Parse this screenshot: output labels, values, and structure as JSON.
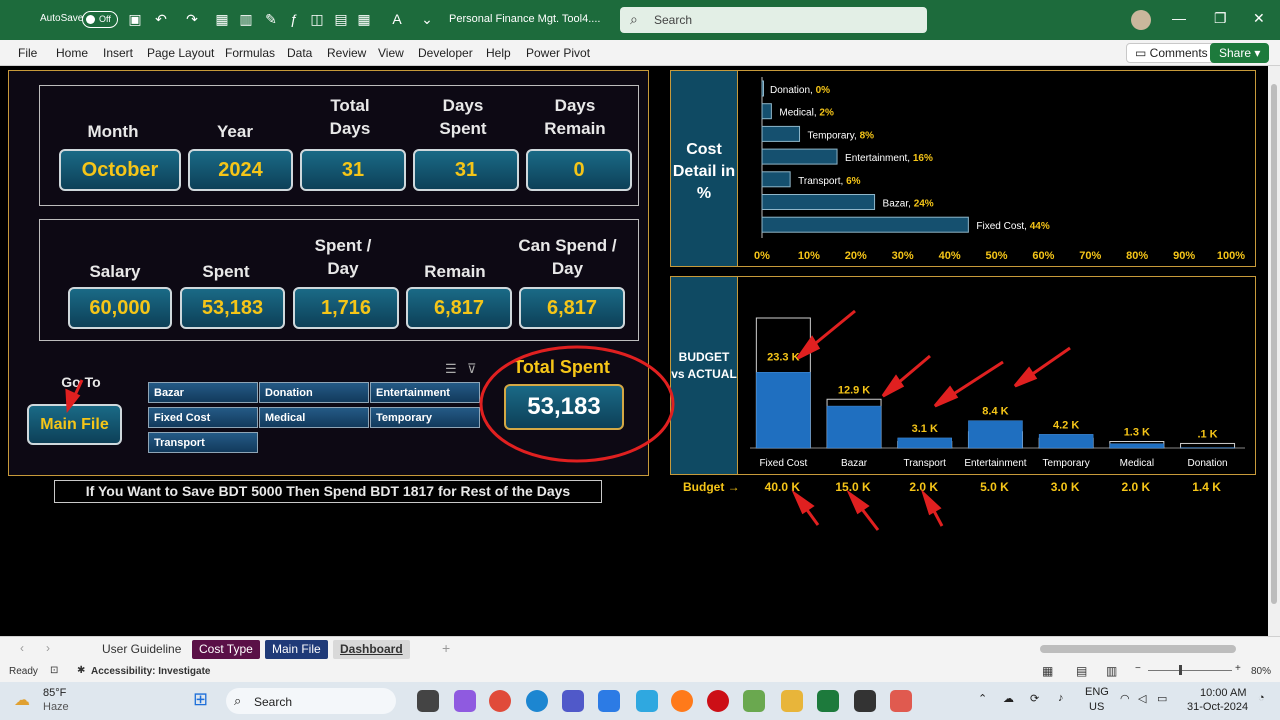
{
  "titlebar": {
    "autosave_label": "AutoSave",
    "toggle_state": "Off",
    "document_title": "Personal Finance Mgt. Tool4....",
    "search_placeholder": "Search"
  },
  "ribbon": {
    "tabs": [
      "File",
      "Home",
      "Insert",
      "Page Layout",
      "Formulas",
      "Data",
      "Review",
      "View",
      "Developer",
      "Help",
      "Power Pivot"
    ],
    "comments_label": "Comments",
    "share_label": "Share"
  },
  "dashboard": {
    "row1": {
      "labels": [
        "Month",
        "Year",
        "Total\nDays",
        "Days\nSpent",
        "Days\nRemain"
      ],
      "values": [
        "October",
        "2024",
        "31",
        "31",
        "0"
      ]
    },
    "row2": {
      "labels": [
        "Salary",
        "Spent",
        "Spent /\nDay",
        "Remain",
        "Can Spend /\nDay"
      ],
      "values": [
        "60,000",
        "53,183",
        "1,716",
        "6,817",
        "6,817"
      ]
    },
    "goto_label": "Go To",
    "main_file_button": "Main File",
    "slicer_items": [
      "Bazar",
      "Donation",
      "Entertainment",
      "Fixed Cost",
      "Medical",
      "Temporary",
      "Transport"
    ],
    "total_spent_label": "Total Spent",
    "total_spent_value": "53,183",
    "save_message": "If You Want to Save BDT 5000 Then Spend BDT  1817  for Rest of the Days"
  },
  "charts": {
    "cost_detail_label": "Cost Detail in %",
    "budget_actual_label": "BUDGET vs ACTUAL",
    "budget_row_label": "Budget →",
    "budget_values": [
      "40.0 K",
      "15.0 K",
      "2.0 K",
      "5.0 K",
      "3.0 K",
      "2.0 K",
      "1.4 K"
    ]
  },
  "chart_data": [
    {
      "type": "bar",
      "orientation": "horizontal",
      "categories": [
        "Donation",
        "Medical",
        "Temporary",
        "Entertainment",
        "Transport",
        "Bazar",
        "Fixed Cost"
      ],
      "values": [
        0,
        2,
        8,
        16,
        6,
        24,
        44
      ],
      "data_labels": [
        "Donation, 0%",
        "Medical, 2%",
        "Temporary, 8%",
        "Entertainment, 16%",
        "Transport, 6%",
        "Bazar, 24%",
        "Fixed Cost, 44%"
      ],
      "xticks": [
        "0%",
        "10%",
        "20%",
        "30%",
        "40%",
        "50%",
        "60%",
        "70%",
        "80%",
        "90%",
        "100%"
      ],
      "xlim": [
        0,
        100
      ],
      "title": "",
      "xlabel": "",
      "ylabel": ""
    },
    {
      "type": "bar",
      "categories": [
        "Fixed Cost",
        "Bazar",
        "Transport",
        "Entertainment",
        "Temporary",
        "Medical",
        "Donation"
      ],
      "series": [
        {
          "values": [
            40.0,
            15.0,
            2.0,
            5.0,
            3.0,
            2.0,
            1.4
          ]
        },
        {
          "values": [
            23.3,
            12.9,
            3.1,
            8.4,
            4.2,
            1.3,
            0.1
          ]
        }
      ],
      "data_labels": [
        "23.3 K",
        "12.9 K",
        "3.1 K",
        "8.4 K",
        "4.2 K",
        "1.3 K",
        ".1 K"
      ],
      "title": "",
      "xlabel": "",
      "ylabel": ""
    }
  ],
  "sheet_tabs": [
    "User Guideline",
    "Cost Type",
    "Main File",
    "Dashboard"
  ],
  "status": {
    "ready": "Ready",
    "accessibility": "Accessibility: Investigate",
    "zoom": "80%"
  },
  "taskbar": {
    "weather_temp": "85°F",
    "weather_desc": "Haze",
    "search_label": "Search",
    "lang1": "ENG",
    "lang2": "US",
    "time": "10:00 AM",
    "date": "31-Oct-2024"
  }
}
